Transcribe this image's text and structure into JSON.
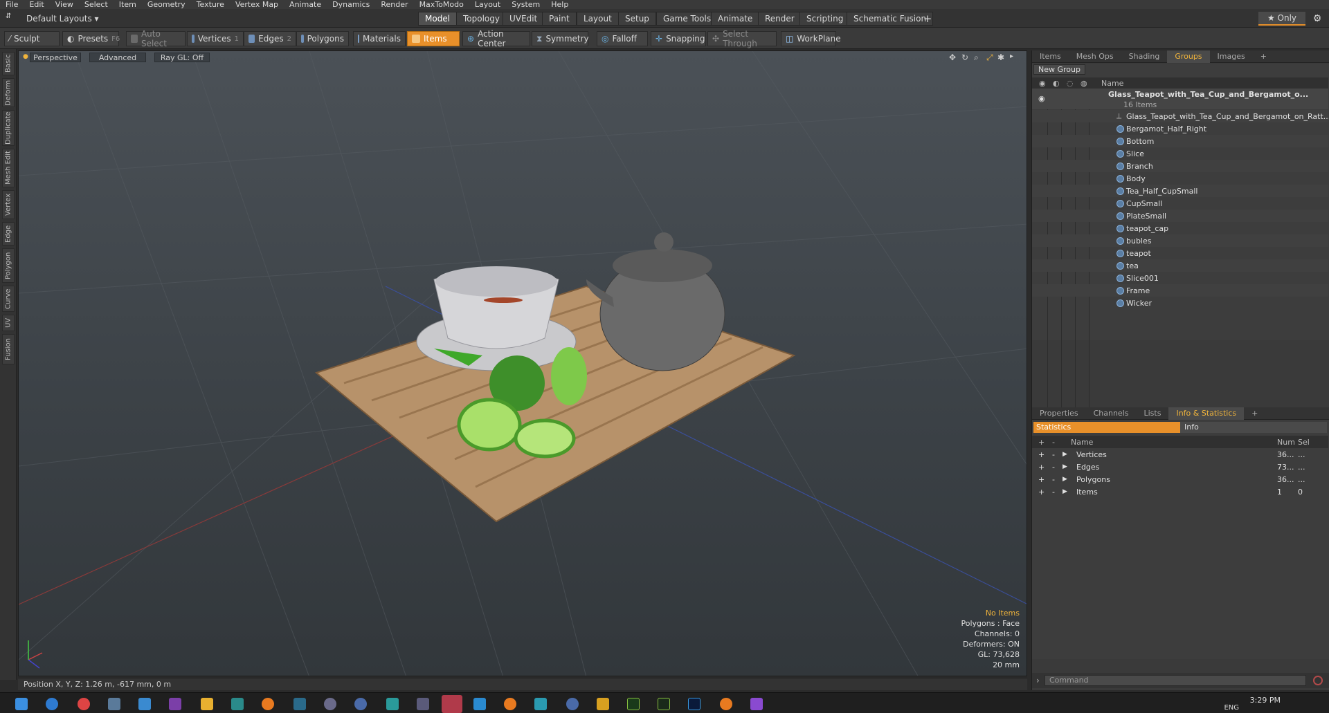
{
  "menu": [
    "File",
    "Edit",
    "View",
    "Select",
    "Item",
    "Geometry",
    "Texture",
    "Vertex Map",
    "Animate",
    "Dynamics",
    "Render",
    "MaxToModo",
    "Layout",
    "System",
    "Help"
  ],
  "layout_dropdown": "Default Layouts ▾",
  "top_tabs": [
    "Model",
    "Topology",
    "UVEdit",
    "Paint",
    "Layout",
    "Setup",
    "Game Tools",
    "Animate",
    "Render",
    "Scripting",
    "Schematic Fusion"
  ],
  "top_tabs_active": "Model",
  "add_tab": "+",
  "only_label": "★ Only",
  "toolbar": {
    "sculpt": "Sculpt",
    "presets": "Presets",
    "presets_key": "F6",
    "auto_select": "Auto Select",
    "vertices": "Vertices",
    "vertices_num": "1",
    "edges": "Edges",
    "edges_num": "2",
    "polygons": "Polygons",
    "materials": "Materials",
    "items": "Items",
    "action_center": "Action Center",
    "symmetry": "Symmetry",
    "falloff": "Falloff",
    "snapping": "Snapping",
    "select_through": "Select Through",
    "workplane": "WorkPlane"
  },
  "left_tabs": [
    "Basic",
    "Deform",
    "Duplicate",
    "Mesh Edit",
    "Vertex",
    "Edge",
    "Polygon",
    "Curve",
    "UV",
    "Fusion"
  ],
  "viewport": {
    "perspective": "Perspective",
    "advanced": "Advanced",
    "raygl": "Ray GL: Off",
    "hud": [
      "No Items",
      "Polygons : Face",
      "Channels: 0",
      "Deformers: ON",
      "GL: 73,628",
      "20 mm"
    ]
  },
  "status_position": "Position X, Y, Z:   1.26 m, -617 mm, 0 m",
  "groups_panel": {
    "tabs": [
      "Items",
      "Mesh Ops",
      "Shading",
      "Groups",
      "Images",
      "+"
    ],
    "active_tab": "Groups",
    "new_group": "New Group",
    "name_header": "Name",
    "group_name": "Glass_Teapot_with_Tea_Cup_and_Bergamot_o...",
    "group_count": "16 Items",
    "items": [
      "Glass_Teapot_with_Tea_Cup_and_Bergamot_on_Ratt...",
      "Bergamot_Half_Right",
      "Bottom",
      "Slice",
      "Branch",
      "Body",
      "Tea_Half_CupSmall",
      "CupSmall",
      "PlateSmall",
      "teapot_cap",
      "bubles",
      "teapot",
      "tea",
      "Slice001",
      "Frame",
      "Wicker"
    ]
  },
  "stats_panel": {
    "tabs": [
      "Properties",
      "Channels",
      "Lists",
      "Info & Statistics",
      "+"
    ],
    "active_tab": "Info & Statistics",
    "subtabs": [
      "Statistics",
      "Info"
    ],
    "headers": {
      "name": "Name",
      "num": "Num",
      "sel": "Sel"
    },
    "rows": [
      {
        "name": "Vertices",
        "num": "36...",
        "sel": "..."
      },
      {
        "name": "Edges",
        "num": "73...",
        "sel": "..."
      },
      {
        "name": "Polygons",
        "num": "36...",
        "sel": "..."
      },
      {
        "name": "Items",
        "num": "1",
        "sel": "0"
      }
    ]
  },
  "command_placeholder": "Command",
  "taskbar": {
    "time": "3:29 PM",
    "lang": "ENG"
  },
  "colors": {
    "accent": "#e8902a",
    "active_tab_text": "#f0b43c"
  }
}
